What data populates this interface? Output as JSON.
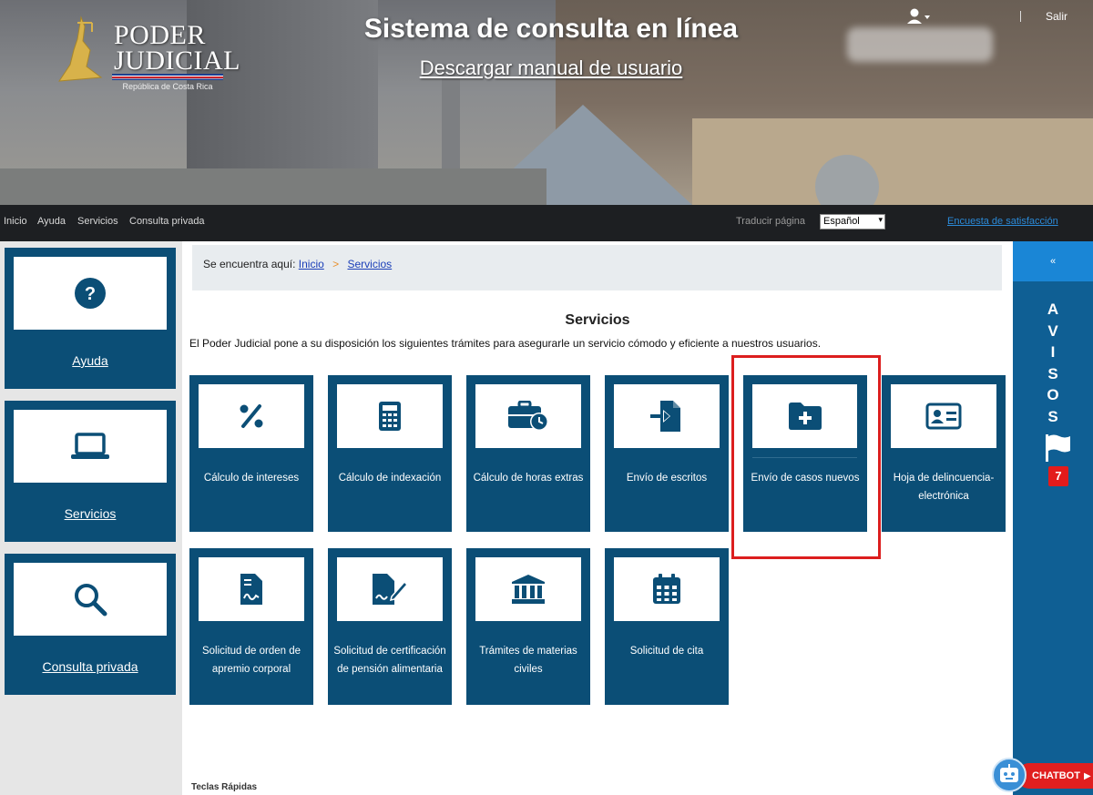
{
  "header": {
    "logo": {
      "line1": "PODER",
      "line2": "JUDICIAL",
      "subtitle": "República de Costa Rica"
    },
    "title": "Sistema de consulta en línea",
    "manual_link": "Descargar manual de usuario",
    "logout": "Salir"
  },
  "nav": {
    "items": [
      "Inicio",
      "Ayuda",
      "Servicios",
      "Consulta privada"
    ],
    "translate_label": "Traducir página",
    "language": "Español",
    "survey_link": "Encuesta de satisfacción"
  },
  "sidebar": {
    "items": [
      {
        "label": "Ayuda",
        "icon": "question-circle-icon"
      },
      {
        "label": "Servicios",
        "icon": "laptop-icon"
      },
      {
        "label": "Consulta privada",
        "icon": "search-icon"
      }
    ]
  },
  "breadcrumb": {
    "prefix": "Se encuentra aquí:",
    "home": "Inicio",
    "separator": ">",
    "current": "Servicios"
  },
  "main": {
    "title": "Servicios",
    "intro": "El Poder Judicial pone a su disposición los siguientes trámites para asegurarle un servicio cómodo y eficiente a nuestros usuarios.",
    "tiles": [
      {
        "label": "Cálculo de intereses",
        "icon": "percent-icon"
      },
      {
        "label": "Cálculo de indexación",
        "icon": "calculator-icon"
      },
      {
        "label": "Cálculo de horas extras",
        "icon": "briefcase-clock-icon"
      },
      {
        "label": "Envío de escritos",
        "icon": "file-import-icon"
      },
      {
        "label": "Envío de casos nuevos",
        "icon": "folder-plus-icon"
      },
      {
        "label": "Hoja de delincuencia-electrónica",
        "icon": "id-card-icon"
      },
      {
        "label": "Solicitud de orden de apremio corporal",
        "icon": "file-signature-icon"
      },
      {
        "label": "Solicitud de certificación de pensión alimentaria",
        "icon": "file-pen-icon"
      },
      {
        "label": "Trámites de materias civiles",
        "icon": "bank-icon"
      },
      {
        "label": "Solicitud de cita",
        "icon": "calendar-icon"
      }
    ],
    "hotkeys": "Teclas Rápidas"
  },
  "avisos": {
    "toggle": "«",
    "letters": [
      "A",
      "V",
      "I",
      "S",
      "O",
      "S"
    ],
    "count": "7"
  },
  "chatbot": {
    "label": "CHATBOT"
  },
  "colors": {
    "tile": "#0b4e76",
    "highlight": "#dc1e1e",
    "avisos": "#0f5f94",
    "navbar": "#1d1f22"
  }
}
